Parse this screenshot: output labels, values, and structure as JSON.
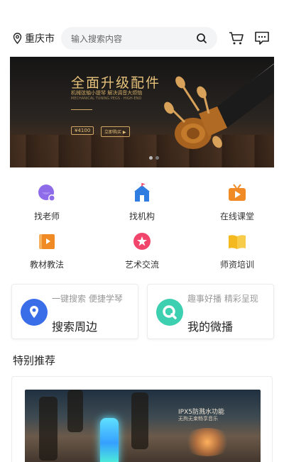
{
  "header": {
    "location": "重庆市",
    "search_placeholder": "输入搜索内容"
  },
  "banner": {
    "headline": "全面升级配件",
    "subline": "机械弦轴小提琴 解决调音大烦恼",
    "small_text": "MECHANICAL TUNING PEGS · HIGH-END",
    "price": "¥4100",
    "buy_label": "立即购买 ▶",
    "slide_count": 2,
    "active_slide": 1
  },
  "categories": [
    {
      "label": "找老师",
      "icon": "teacher-icon",
      "color": "#8e6be8"
    },
    {
      "label": "找机构",
      "icon": "institution-icon",
      "color": "#2f7de1"
    },
    {
      "label": "在线课堂",
      "icon": "online-class-icon",
      "color": "#f08a24"
    },
    {
      "label": "教材教法",
      "icon": "textbook-icon",
      "color": "#f08a24"
    },
    {
      "label": "艺术交流",
      "icon": "art-exchange-icon",
      "color": "#f2456b"
    },
    {
      "label": "师资培训",
      "icon": "training-icon",
      "color": "#f5b920"
    }
  ],
  "features": [
    {
      "small": "一键搜索 便捷学琴",
      "title": "搜索周边",
      "icon": "location-pin-icon",
      "color": "#3a6ee8"
    },
    {
      "small": "趣事好播 精彩呈现",
      "title": "我的微播",
      "icon": "micro-broadcast-icon",
      "color": "#3ccfb0"
    }
  ],
  "recommend": {
    "section_title": "特别推荐",
    "image_caption_1": "IPX5防溅水功能",
    "image_caption_2": "无拘无束畅享音乐"
  },
  "colors": {
    "accent_blue": "#3a6ee8",
    "accent_teal": "#3ccfb0",
    "search_bg": "#f3f4f6"
  }
}
